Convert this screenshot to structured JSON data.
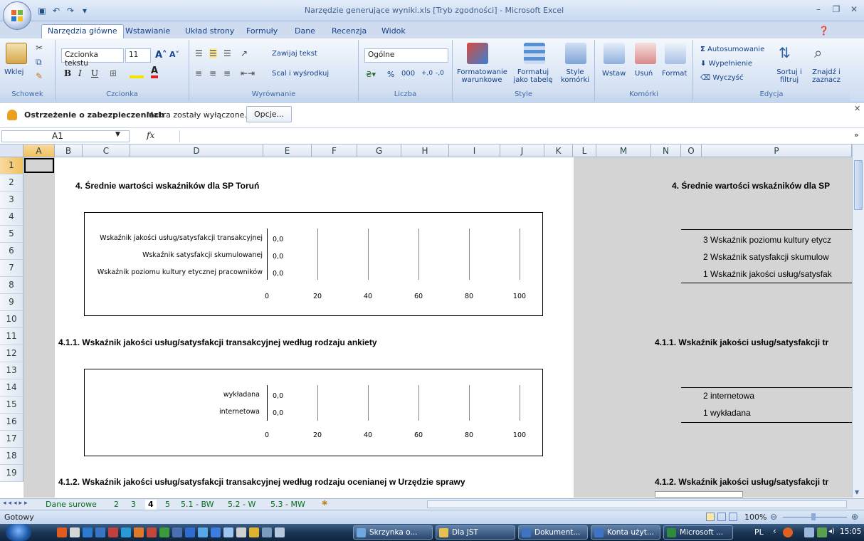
{
  "window": {
    "title": "Narzędzie generujące wyniki.xls  [Tryb zgodności] - Microsoft Excel"
  },
  "ribbon_tabs": [
    "Narzędzia główne",
    "Wstawianie",
    "Układ strony",
    "Formuły",
    "Dane",
    "Recenzja",
    "Widok"
  ],
  "ribbon": {
    "clipboard": {
      "paste": "Wklej",
      "label": "Schowek"
    },
    "font": {
      "name": "Czcionka tekstu",
      "size": "11",
      "label": "Czcionka"
    },
    "alignment": {
      "wrap": "Zawijaj tekst",
      "merge": "Scal i wyśrodkuj",
      "label": "Wyrównanie"
    },
    "number": {
      "format": "Ogólne",
      "label": "Liczba"
    },
    "styles": {
      "cond": "Formatowanie warunkowe",
      "table": "Formatuj jako tabelę",
      "cell": "Style komórki",
      "label": "Style"
    },
    "cells": {
      "insert": "Wstaw",
      "delete": "Usuń",
      "format": "Format",
      "label": "Komórki"
    },
    "editing": {
      "autosum": "Autosumowanie",
      "fill": "Wypełnienie",
      "clear": "Wyczyść",
      "sort": "Sortuj i filtruj",
      "find": "Znajdź i zaznacz",
      "label": "Edycja"
    }
  },
  "security": {
    "title": "Ostrzeżenie o zabezpieczeniach",
    "message": "Makra zostały wyłączone.",
    "button": "Opcje..."
  },
  "formula_bar": {
    "cell": "A1",
    "fx": "fx",
    "value": ""
  },
  "columns": [
    "A",
    "B",
    "C",
    "D",
    "E",
    "F",
    "G",
    "H",
    "I",
    "J",
    "K",
    "L",
    "M",
    "N",
    "O",
    "P"
  ],
  "rows": [
    "1",
    "2",
    "3",
    "4",
    "5",
    "6",
    "7",
    "8",
    "9",
    "10",
    "11",
    "12",
    "13",
    "14",
    "15",
    "16",
    "17",
    "18",
    "19"
  ],
  "sheet": {
    "h1": "4. Średnie wartości wskaźników dla SP Toruń",
    "h2": "4.1.1. Wskaźnik jakości usług/satysfakcji transakcyjnej według rodzaju ankiety",
    "h3": "4.1.2. Wskaźnik jakości usług/satysfakcji transakcyjnej według rodzaju ocenianej w Urzędzie sprawy",
    "right_h1": "4. Średnie wartości wskaźników dla SP",
    "right_h2": "4.1.1. Wskaźnik jakości usług/satysfakcji tr",
    "right_h3": "4.1.2. Wskaźnik jakości usług/satysfakcji tr",
    "right_list1": [
      "3 Wskaźnik poziomu kultury etycz",
      "2 Wskaźnik satysfakcji skumulow",
      "1 Wskaźnik jakości usług/satysfak"
    ],
    "right_list2": [
      "2 internetowa",
      "1 wykładana"
    ]
  },
  "chart_data": [
    {
      "type": "bar",
      "categories": [
        "Wskaźnik jakości usług/satysfakcji transakcyjnej",
        "Wskaźnik satysfakcji skumulowanej",
        "Wskaźnik poziomu kultury etycznej pracowników"
      ],
      "values": [
        0.0,
        0.0,
        0.0
      ],
      "value_labels": [
        "0,0",
        "0,0",
        "0,0"
      ],
      "xlim": [
        0,
        100
      ],
      "ticks": [
        "0",
        "20",
        "40",
        "60",
        "80",
        "100"
      ],
      "orientation": "horizontal"
    },
    {
      "type": "bar",
      "categories": [
        "wykładana",
        "internetowa"
      ],
      "values": [
        0.0,
        0.0
      ],
      "value_labels": [
        "0,0",
        "0,0"
      ],
      "xlim": [
        0,
        100
      ],
      "ticks": [
        "0",
        "20",
        "40",
        "60",
        "80",
        "100"
      ],
      "orientation": "horizontal"
    }
  ],
  "sheet_tabs": [
    "Dane surowe",
    "2",
    "3",
    "4",
    "5",
    "5.1 - BW",
    "5.2 - W",
    "5.3 - MW"
  ],
  "active_sheet": "4",
  "status": {
    "ready": "Gotowy",
    "zoom": "100%"
  },
  "taskbar": {
    "buttons": [
      "Skrzynka o...",
      "Dla JST",
      "Dokument...",
      "Konta użyt...",
      "Microsoft ..."
    ],
    "lang": "PL",
    "time": "15:05"
  }
}
